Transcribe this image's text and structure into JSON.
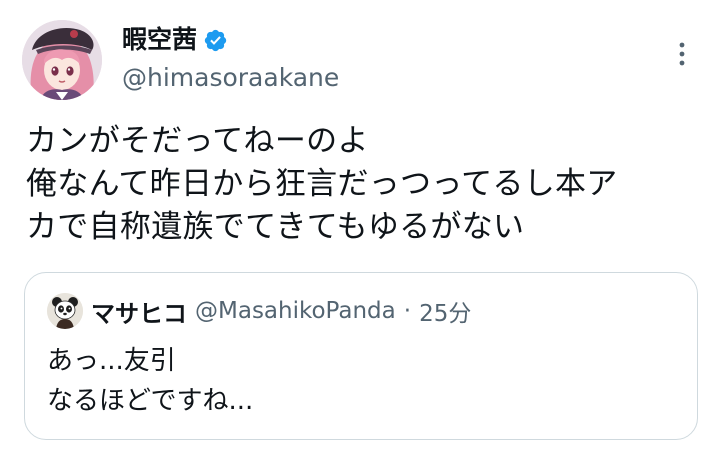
{
  "author": {
    "display_name": "暇空茜",
    "handle": "@himasoraakane",
    "avatar_icon": "anime-girl-avatar",
    "verified_icon": "verified-badge-icon",
    "verified_color": "#1d9bf0"
  },
  "menu": {
    "icon": "more-vertical-icon"
  },
  "tweet": {
    "text": "カンがそだってねーのよ\n俺なんて昨日から狂言だっつってるし本ア\nカで自称遺族でてきてもゆるがない"
  },
  "quote": {
    "avatar_icon": "panda-avatar",
    "display_name": "マサヒコ",
    "handle": "@MasahikoPanda",
    "separator": "·",
    "time": "25分",
    "text": "あっ...友引\nなるほどですね..."
  },
  "colors": {
    "text_primary": "#0f1419",
    "text_secondary": "#536471",
    "border": "#cfd9de"
  }
}
